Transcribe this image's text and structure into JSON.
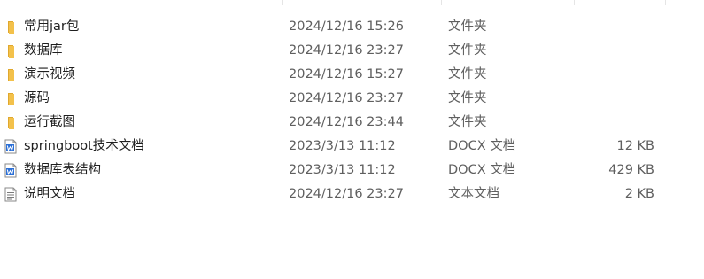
{
  "files": [
    {
      "name": "常用jar包",
      "date": "2024/12/16 15:26",
      "type": "文件夹",
      "size": "",
      "icon": "folder-icon"
    },
    {
      "name": "数据库",
      "date": "2024/12/16 23:27",
      "type": "文件夹",
      "size": "",
      "icon": "folder-icon"
    },
    {
      "name": "演示视频",
      "date": "2024/12/16 15:27",
      "type": "文件夹",
      "size": "",
      "icon": "folder-icon"
    },
    {
      "name": "源码",
      "date": "2024/12/16 23:27",
      "type": "文件夹",
      "size": "",
      "icon": "folder-icon"
    },
    {
      "name": "运行截图",
      "date": "2024/12/16 23:44",
      "type": "文件夹",
      "size": "",
      "icon": "folder-icon"
    },
    {
      "name": "springboot技术文档",
      "date": "2023/3/13 11:12",
      "type": "DOCX 文档",
      "size": "12 KB",
      "icon": "word-document-icon"
    },
    {
      "name": "数据库表结构",
      "date": "2023/3/13 11:12",
      "type": "DOCX 文档",
      "size": "429 KB",
      "icon": "word-document-icon"
    },
    {
      "name": "说明文档",
      "date": "2024/12/16 23:27",
      "type": "文本文档",
      "size": "2 KB",
      "icon": "text-document-icon"
    }
  ],
  "colors": {
    "folder": "#f3c14b",
    "folder_dark": "#e0a82e",
    "word": "#2b6fd6"
  }
}
